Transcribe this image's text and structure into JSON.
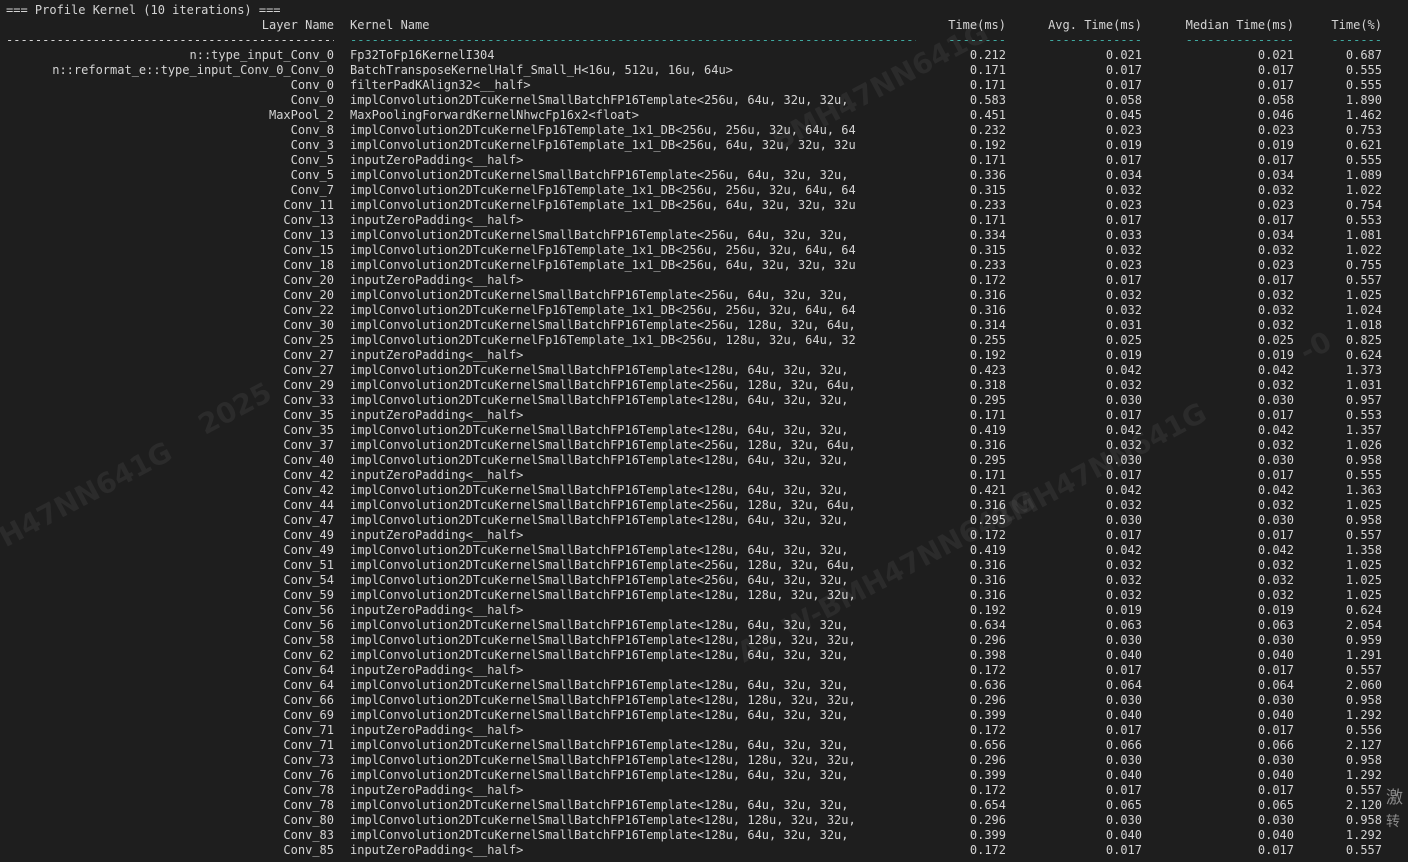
{
  "terminal": {
    "header_title": "=== Profile Kernel (10 iterations) ===",
    "columns": {
      "layer": "Layer Name",
      "kernel": "Kernel Name",
      "time": "Time(ms)",
      "avg": "Avg. Time(ms)",
      "median": "Median Time(ms)",
      "pct": "Time(%)"
    },
    "separators": {
      "layer": "----------------------------------------------------",
      "kernel": "----------------------------------------------------------------------------------------",
      "time": "--------",
      "avg": "-------------",
      "median": "---------------",
      "pct": "-------"
    },
    "rows": [
      {
        "layer": "n::type_input_Conv_0",
        "kernel": "Fp32ToFp16KernelI304",
        "time": "0.212",
        "avg": "0.021",
        "median": "0.021",
        "pct": "0.687"
      },
      {
        "layer": "n::reformat_e::type_input_Conv_0_Conv_0",
        "kernel": "BatchTransposeKernelHalf_Small_H<16u, 512u, 16u, 64u>",
        "time": "0.171",
        "avg": "0.017",
        "median": "0.017",
        "pct": "0.555"
      },
      {
        "layer": "Conv_0",
        "kernel": "filterPadKAlign32<__half>",
        "time": "0.171",
        "avg": "0.017",
        "median": "0.017",
        "pct": "0.555"
      },
      {
        "layer": "Conv_0",
        "kernel": "implConvolution2DTcuKernelSmallBatchFP16Template<256u, 64u, 32u, 32u,",
        "time": "0.583",
        "avg": "0.058",
        "median": "0.058",
        "pct": "1.890"
      },
      {
        "layer": "MaxPool_2",
        "kernel": "MaxPoolingForwardKernelNhwcFp16x2<float>",
        "time": "0.451",
        "avg": "0.045",
        "median": "0.046",
        "pct": "1.462"
      },
      {
        "layer": "Conv_8",
        "kernel": "implConvolution2DTcuKernelFp16Template_1x1_DB<256u, 256u, 32u, 64u, 64",
        "time": "0.232",
        "avg": "0.023",
        "median": "0.023",
        "pct": "0.753"
      },
      {
        "layer": "Conv_3",
        "kernel": "implConvolution2DTcuKernelFp16Template_1x1_DB<256u, 64u, 32u, 32u, 32u",
        "time": "0.192",
        "avg": "0.019",
        "median": "0.019",
        "pct": "0.621"
      },
      {
        "layer": "Conv_5",
        "kernel": "inputZeroPadding<__half>",
        "time": "0.171",
        "avg": "0.017",
        "median": "0.017",
        "pct": "0.555"
      },
      {
        "layer": "Conv_5",
        "kernel": "implConvolution2DTcuKernelSmallBatchFP16Template<256u, 64u, 32u, 32u,",
        "time": "0.336",
        "avg": "0.034",
        "median": "0.034",
        "pct": "1.089"
      },
      {
        "layer": "Conv_7",
        "kernel": "implConvolution2DTcuKernelFp16Template_1x1_DB<256u, 256u, 32u, 64u, 64",
        "time": "0.315",
        "avg": "0.032",
        "median": "0.032",
        "pct": "1.022"
      },
      {
        "layer": "Conv_11",
        "kernel": "implConvolution2DTcuKernelFp16Template_1x1_DB<256u, 64u, 32u, 32u, 32u",
        "time": "0.233",
        "avg": "0.023",
        "median": "0.023",
        "pct": "0.754"
      },
      {
        "layer": "Conv_13",
        "kernel": "inputZeroPadding<__half>",
        "time": "0.171",
        "avg": "0.017",
        "median": "0.017",
        "pct": "0.553"
      },
      {
        "layer": "Conv_13",
        "kernel": "implConvolution2DTcuKernelSmallBatchFP16Template<256u, 64u, 32u, 32u,",
        "time": "0.334",
        "avg": "0.033",
        "median": "0.034",
        "pct": "1.081"
      },
      {
        "layer": "Conv_15",
        "kernel": "implConvolution2DTcuKernelFp16Template_1x1_DB<256u, 256u, 32u, 64u, 64",
        "time": "0.315",
        "avg": "0.032",
        "median": "0.032",
        "pct": "1.022"
      },
      {
        "layer": "Conv_18",
        "kernel": "implConvolution2DTcuKernelFp16Template_1x1_DB<256u, 64u, 32u, 32u, 32u",
        "time": "0.233",
        "avg": "0.023",
        "median": "0.023",
        "pct": "0.755"
      },
      {
        "layer": "Conv_20",
        "kernel": "inputZeroPadding<__half>",
        "time": "0.172",
        "avg": "0.017",
        "median": "0.017",
        "pct": "0.557"
      },
      {
        "layer": "Conv_20",
        "kernel": "implConvolution2DTcuKernelSmallBatchFP16Template<256u, 64u, 32u, 32u,",
        "time": "0.316",
        "avg": "0.032",
        "median": "0.032",
        "pct": "1.025"
      },
      {
        "layer": "Conv_22",
        "kernel": "implConvolution2DTcuKernelFp16Template_1x1_DB<256u, 256u, 32u, 64u, 64",
        "time": "0.316",
        "avg": "0.032",
        "median": "0.032",
        "pct": "1.024"
      },
      {
        "layer": "Conv_30",
        "kernel": "implConvolution2DTcuKernelSmallBatchFP16Template<256u, 128u, 32u, 64u,",
        "time": "0.314",
        "avg": "0.031",
        "median": "0.032",
        "pct": "1.018"
      },
      {
        "layer": "Conv_25",
        "kernel": "implConvolution2DTcuKernelFp16Template_1x1_DB<256u, 128u, 32u, 64u, 32",
        "time": "0.255",
        "avg": "0.025",
        "median": "0.025",
        "pct": "0.825"
      },
      {
        "layer": "Conv_27",
        "kernel": "inputZeroPadding<__half>",
        "time": "0.192",
        "avg": "0.019",
        "median": "0.019",
        "pct": "0.624"
      },
      {
        "layer": "Conv_27",
        "kernel": "implConvolution2DTcuKernelSmallBatchFP16Template<128u, 64u, 32u, 32u,",
        "time": "0.423",
        "avg": "0.042",
        "median": "0.042",
        "pct": "1.373"
      },
      {
        "layer": "Conv_29",
        "kernel": "implConvolution2DTcuKernelSmallBatchFP16Template<256u, 128u, 32u, 64u,",
        "time": "0.318",
        "avg": "0.032",
        "median": "0.032",
        "pct": "1.031"
      },
      {
        "layer": "Conv_33",
        "kernel": "implConvolution2DTcuKernelSmallBatchFP16Template<128u, 64u, 32u, 32u,",
        "time": "0.295",
        "avg": "0.030",
        "median": "0.030",
        "pct": "0.957"
      },
      {
        "layer": "Conv_35",
        "kernel": "inputZeroPadding<__half>",
        "time": "0.171",
        "avg": "0.017",
        "median": "0.017",
        "pct": "0.553"
      },
      {
        "layer": "Conv_35",
        "kernel": "implConvolution2DTcuKernelSmallBatchFP16Template<128u, 64u, 32u, 32u,",
        "time": "0.419",
        "avg": "0.042",
        "median": "0.042",
        "pct": "1.357"
      },
      {
        "layer": "Conv_37",
        "kernel": "implConvolution2DTcuKernelSmallBatchFP16Template<256u, 128u, 32u, 64u,",
        "time": "0.316",
        "avg": "0.032",
        "median": "0.032",
        "pct": "1.026"
      },
      {
        "layer": "Conv_40",
        "kernel": "implConvolution2DTcuKernelSmallBatchFP16Template<128u, 64u, 32u, 32u,",
        "time": "0.295",
        "avg": "0.030",
        "median": "0.030",
        "pct": "0.958"
      },
      {
        "layer": "Conv_42",
        "kernel": "inputZeroPadding<__half>",
        "time": "0.171",
        "avg": "0.017",
        "median": "0.017",
        "pct": "0.555"
      },
      {
        "layer": "Conv_42",
        "kernel": "implConvolution2DTcuKernelSmallBatchFP16Template<128u, 64u, 32u, 32u,",
        "time": "0.421",
        "avg": "0.042",
        "median": "0.042",
        "pct": "1.363"
      },
      {
        "layer": "Conv_44",
        "kernel": "implConvolution2DTcuKernelSmallBatchFP16Template<256u, 128u, 32u, 64u,",
        "time": "0.316",
        "avg": "0.032",
        "median": "0.032",
        "pct": "1.025"
      },
      {
        "layer": "Conv_47",
        "kernel": "implConvolution2DTcuKernelSmallBatchFP16Template<128u, 64u, 32u, 32u,",
        "time": "0.295",
        "avg": "0.030",
        "median": "0.030",
        "pct": "0.958"
      },
      {
        "layer": "Conv_49",
        "kernel": "inputZeroPadding<__half>",
        "time": "0.172",
        "avg": "0.017",
        "median": "0.017",
        "pct": "0.557"
      },
      {
        "layer": "Conv_49",
        "kernel": "implConvolution2DTcuKernelSmallBatchFP16Template<128u, 64u, 32u, 32u,",
        "time": "0.419",
        "avg": "0.042",
        "median": "0.042",
        "pct": "1.358"
      },
      {
        "layer": "Conv_51",
        "kernel": "implConvolution2DTcuKernelSmallBatchFP16Template<256u, 128u, 32u, 64u,",
        "time": "0.316",
        "avg": "0.032",
        "median": "0.032",
        "pct": "1.025"
      },
      {
        "layer": "Conv_54",
        "kernel": "implConvolution2DTcuKernelSmallBatchFP16Template<256u, 64u, 32u, 32u,",
        "time": "0.316",
        "avg": "0.032",
        "median": "0.032",
        "pct": "1.025"
      },
      {
        "layer": "Conv_59",
        "kernel": "implConvolution2DTcuKernelSmallBatchFP16Template<128u, 128u, 32u, 32u,",
        "time": "0.316",
        "avg": "0.032",
        "median": "0.032",
        "pct": "1.025"
      },
      {
        "layer": "Conv_56",
        "kernel": "inputZeroPadding<__half>",
        "time": "0.192",
        "avg": "0.019",
        "median": "0.019",
        "pct": "0.624"
      },
      {
        "layer": "Conv_56",
        "kernel": "implConvolution2DTcuKernelSmallBatchFP16Template<128u, 64u, 32u, 32u,",
        "time": "0.634",
        "avg": "0.063",
        "median": "0.063",
        "pct": "2.054"
      },
      {
        "layer": "Conv_58",
        "kernel": "implConvolution2DTcuKernelSmallBatchFP16Template<128u, 128u, 32u, 32u,",
        "time": "0.296",
        "avg": "0.030",
        "median": "0.030",
        "pct": "0.959"
      },
      {
        "layer": "Conv_62",
        "kernel": "implConvolution2DTcuKernelSmallBatchFP16Template<128u, 64u, 32u, 32u,",
        "time": "0.398",
        "avg": "0.040",
        "median": "0.040",
        "pct": "1.291"
      },
      {
        "layer": "Conv_64",
        "kernel": "inputZeroPadding<__half>",
        "time": "0.172",
        "avg": "0.017",
        "median": "0.017",
        "pct": "0.557"
      },
      {
        "layer": "Conv_64",
        "kernel": "implConvolution2DTcuKernelSmallBatchFP16Template<128u, 64u, 32u, 32u,",
        "time": "0.636",
        "avg": "0.064",
        "median": "0.064",
        "pct": "2.060"
      },
      {
        "layer": "Conv_66",
        "kernel": "implConvolution2DTcuKernelSmallBatchFP16Template<128u, 128u, 32u, 32u,",
        "time": "0.296",
        "avg": "0.030",
        "median": "0.030",
        "pct": "0.958"
      },
      {
        "layer": "Conv_69",
        "kernel": "implConvolution2DTcuKernelSmallBatchFP16Template<128u, 64u, 32u, 32u,",
        "time": "0.399",
        "avg": "0.040",
        "median": "0.040",
        "pct": "1.292"
      },
      {
        "layer": "Conv_71",
        "kernel": "inputZeroPadding<__half>",
        "time": "0.172",
        "avg": "0.017",
        "median": "0.017",
        "pct": "0.556"
      },
      {
        "layer": "Conv_71",
        "kernel": "implConvolution2DTcuKernelSmallBatchFP16Template<128u, 64u, 32u, 32u,",
        "time": "0.656",
        "avg": "0.066",
        "median": "0.066",
        "pct": "2.127"
      },
      {
        "layer": "Conv_73",
        "kernel": "implConvolution2DTcuKernelSmallBatchFP16Template<128u, 128u, 32u, 32u,",
        "time": "0.296",
        "avg": "0.030",
        "median": "0.030",
        "pct": "0.958"
      },
      {
        "layer": "Conv_76",
        "kernel": "implConvolution2DTcuKernelSmallBatchFP16Template<128u, 64u, 32u, 32u,",
        "time": "0.399",
        "avg": "0.040",
        "median": "0.040",
        "pct": "1.292"
      },
      {
        "layer": "Conv_78",
        "kernel": "inputZeroPadding<__half>",
        "time": "0.172",
        "avg": "0.017",
        "median": "0.017",
        "pct": "0.557"
      },
      {
        "layer": "Conv_78",
        "kernel": "implConvolution2DTcuKernelSmallBatchFP16Template<128u, 64u, 32u, 32u,",
        "time": "0.654",
        "avg": "0.065",
        "median": "0.065",
        "pct": "2.120"
      },
      {
        "layer": "Conv_80",
        "kernel": "implConvolution2DTcuKernelSmallBatchFP16Template<128u, 128u, 32u, 32u,",
        "time": "0.296",
        "avg": "0.030",
        "median": "0.030",
        "pct": "0.958"
      },
      {
        "layer": "Conv_83",
        "kernel": "implConvolution2DTcuKernelSmallBatchFP16Template<128u, 64u, 32u, 32u,",
        "time": "0.399",
        "avg": "0.040",
        "median": "0.040",
        "pct": "1.292"
      },
      {
        "layer": "Conv_85",
        "kernel": "inputZeroPadding<__half>",
        "time": "0.172",
        "avg": "0.017",
        "median": "0.017",
        "pct": "0.557"
      }
    ]
  },
  "overlay": {
    "watermarks": [
      "2025",
      "H47NN641G",
      "BMH47NN641G",
      "A3 W-BMH47NN641G",
      "8MH47NN641G",
      "-0"
    ],
    "corner_chars": [
      "激",
      "转"
    ]
  },
  "colors": {
    "background": "#1e1e1e",
    "text": "#d4d4d4",
    "separator_accent": "#3fa9a0"
  }
}
